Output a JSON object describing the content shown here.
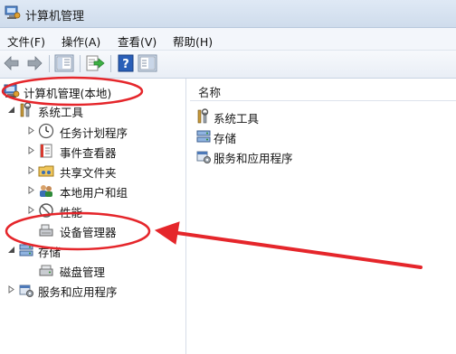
{
  "window": {
    "title": "计算机管理"
  },
  "menu": [
    "文件(F)",
    "操作(A)",
    "查看(V)",
    "帮助(H)"
  ],
  "toolbar": {
    "buttons": [
      "back-icon",
      "forward-icon",
      "show-hide-tree-icon",
      "export-list-icon",
      "help-icon",
      "properties-icon"
    ]
  },
  "tree": {
    "root": "计算机管理(本地)",
    "system_tools": "系统工具",
    "task_scheduler": "任务计划程序",
    "event_viewer": "事件查看器",
    "shared_folders": "共享文件夹",
    "local_users": "本地用户和组",
    "performance": "性能",
    "device_manager": "设备管理器",
    "storage": "存储",
    "disk_management": "磁盘管理",
    "services_apps": "服务和应用程序"
  },
  "list": {
    "header": "名称",
    "items": [
      "系统工具",
      "存储",
      "服务和应用程序"
    ]
  },
  "colors": {
    "annotation": "#e5262b",
    "selection": "#cde4f7"
  }
}
